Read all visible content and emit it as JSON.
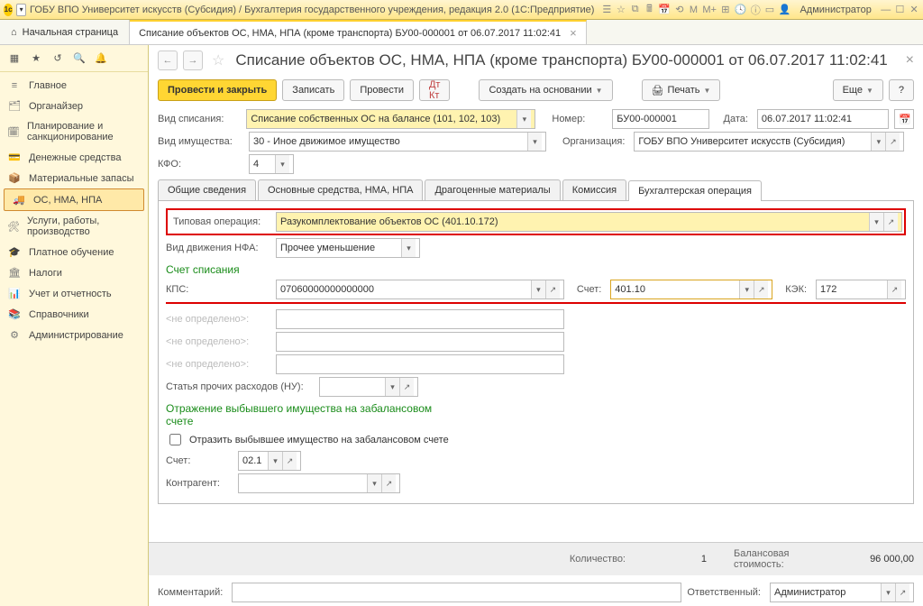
{
  "titlebar": {
    "title": "ГОБУ ВПО Университет искусств (Субсидия) / Бухгалтерия государственного учреждения, редакция 2.0  (1С:Предприятие)",
    "user": "Администратор"
  },
  "tabs": {
    "home": "Начальная страница",
    "doc": "Списание объектов ОС, НМА, НПА (кроме транспорта) БУ00-000001 от 06.07.2017 11:02:41"
  },
  "nav": {
    "items": [
      "Главное",
      "Органайзер",
      "Планирование и санкционирование",
      "Денежные средства",
      "Материальные запасы",
      "ОС, НМА, НПА",
      "Услуги, работы, производство",
      "Платное обучение",
      "Налоги",
      "Учет и отчетность",
      "Справочники",
      "Администрирование"
    ]
  },
  "doc": {
    "title": "Списание объектов ОС, НМА, НПА (кроме транспорта) БУ00-000001 от 06.07.2017 11:02:41",
    "buttons": {
      "post_close": "Провести и закрыть",
      "save": "Записать",
      "post": "Провести",
      "create_based": "Создать на основании",
      "print": "Печать",
      "more": "Еще"
    },
    "labels": {
      "writeoff_type": "Вид списания:",
      "property_type": "Вид имущества:",
      "kfo": "КФО:",
      "number": "Номер:",
      "date": "Дата:",
      "org": "Организация:"
    },
    "values": {
      "writeoff_type": "Списание собственных ОС на балансе (101, 102, 103)",
      "property_type": "30 - Иное движимое имущество",
      "kfo": "4",
      "number": "БУ00-000001",
      "date": "06.07.2017 11:02:41",
      "org": "ГОБУ ВПО Университет искусств (Субсидия)"
    },
    "tab_headers": [
      "Общие сведения",
      "Основные средства, НМА, НПА",
      "Драгоценные материалы",
      "Комиссия",
      "Бухгалтерская операция"
    ],
    "acct": {
      "typical_op_label": "Типовая операция:",
      "typical_op": "Разукомплектование объектов ОС (401.10.172)",
      "movement_label": "Вид движения НФА:",
      "movement": "Прочее уменьшение",
      "sect_writeoff": "Счет списания",
      "kps_label": "КПС:",
      "kps": "07060000000000000",
      "account_label": "Счет:",
      "account": "401.10",
      "kek_label": "КЭК:",
      "kek": "172",
      "undef": "<не определено>:",
      "expense_label": "Статья прочих расходов (НУ):",
      "sect_offbal": "Отражение выбывшего имущества на забалансовом счете",
      "offbal_chk": "Отразить выбывшее имущество на забалансовом счете",
      "offbal_account": "02.1",
      "counterparty_label": "Контрагент:"
    },
    "footer": {
      "qty_label": "Количество:",
      "qty": "1",
      "bal_label": "Балансовая стоимость:",
      "bal": "96 000,00",
      "comment_label": "Комментарий:",
      "resp_label": "Ответственный:",
      "resp": "Администратор"
    }
  }
}
